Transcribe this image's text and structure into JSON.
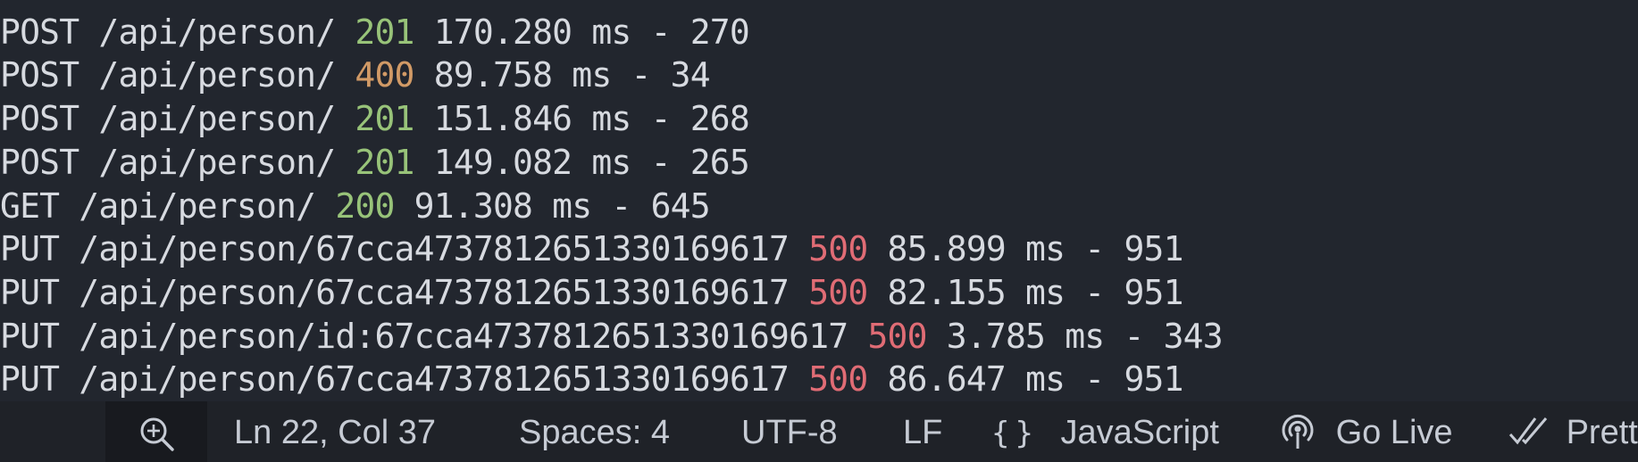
{
  "log_lines": [
    {
      "prefix": "POST /api/person/ ",
      "status": "201",
      "status_class": "s2xx",
      "suffix": " 170.280 ms - 270"
    },
    {
      "prefix": "POST /api/person/ ",
      "status": "400",
      "status_class": "s4xx",
      "suffix": " 89.758 ms - 34"
    },
    {
      "prefix": "POST /api/person/ ",
      "status": "201",
      "status_class": "s2xx",
      "suffix": " 151.846 ms - 268"
    },
    {
      "prefix": "POST /api/person/ ",
      "status": "201",
      "status_class": "s2xx",
      "suffix": " 149.082 ms - 265"
    },
    {
      "prefix": "GET /api/person/ ",
      "status": "200",
      "status_class": "s2xx",
      "suffix": " 91.308 ms - 645"
    },
    {
      "prefix": "PUT /api/person/67cca47378126513301696​17 ",
      "status": "500",
      "status_class": "s5xx",
      "suffix": " 85.899 ms - 951"
    },
    {
      "prefix": "PUT /api/person/67cca4737812651330169617 ",
      "status": "500",
      "status_class": "s5xx",
      "suffix": " 82.155 ms - 951"
    },
    {
      "prefix": "PUT /api/person/id:67cca4737812651330169617 ",
      "status": "500",
      "status_class": "s5xx",
      "suffix": " 3.785 ms - 343"
    },
    {
      "prefix": "PUT /api/person/67cca4737812651330169617 ",
      "status": "500",
      "status_class": "s5xx",
      "suffix": " 86.647 ms - 951"
    }
  ],
  "status_colors": {
    "s2xx": "#98c379",
    "s4xx": "#d19a66",
    "s5xx": "#e06c75"
  },
  "statusbar": {
    "zoom_icon": "zoom-in-icon",
    "cursor_position": "Ln 22, Col 37",
    "indentation": "Spaces: 4",
    "encoding": "UTF-8",
    "line_ending": "LF",
    "language_icon": "braces-icon",
    "language": "JavaScript",
    "go_live_icon": "broadcast-icon",
    "go_live": "Go Live",
    "prettier_icon": "double-check-icon",
    "prettier": "Prett"
  }
}
